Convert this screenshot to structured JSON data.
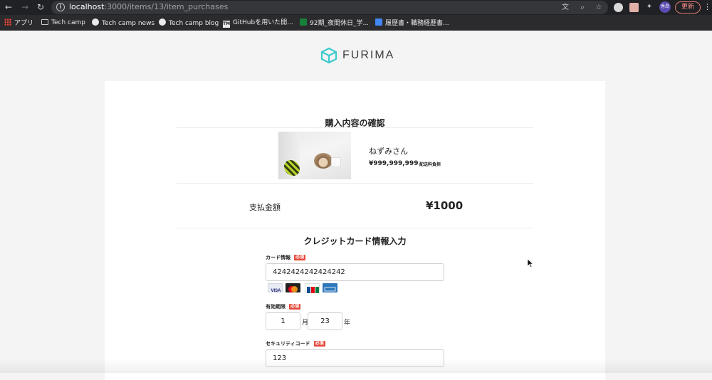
{
  "browser": {
    "url_host": "localhost",
    "url_path": ":3000/items/13/item_purchases",
    "profile_initials": "秀昂",
    "update_label": "更新",
    "bookmarks": [
      {
        "label": "アプリ",
        "icon": "apps-icon"
      },
      {
        "label": "Tech camp",
        "icon": "folder-icon"
      },
      {
        "label": "Tech camp news",
        "icon": "globe-icon"
      },
      {
        "label": "Tech camp blog",
        "icon": "globe-icon"
      },
      {
        "label": "GitHubを用いた開...",
        "icon": "tm-icon"
      },
      {
        "label": "92期_夜間休日_学...",
        "icon": "sheets-icon"
      },
      {
        "label": "履歴書・職務経歴書...",
        "icon": "docs-icon"
      }
    ]
  },
  "site": {
    "logo_text": "FURIMA",
    "brand_color": "#3ccace"
  },
  "purchase": {
    "confirm_title": "購入内容の確認",
    "item_name": "ねずみさん",
    "item_price": "¥999,999,999",
    "shipping_note": "配送料負担",
    "payment_label": "支払金額",
    "payment_amount": "¥1000"
  },
  "card_form": {
    "title": "クレジットカード情報入力",
    "card_label": "カード情報",
    "required_label": "必須",
    "card_number": "4242424242424242",
    "expiry_label": "有効期限",
    "expiry_month": "1",
    "month_unit": "月",
    "expiry_year": "23",
    "year_unit": "年",
    "cvc_label": "セキュリティコード",
    "cvc_value": "123",
    "card_brands": [
      "VISA",
      "Mastercard",
      "JCB",
      "AMEX"
    ]
  }
}
